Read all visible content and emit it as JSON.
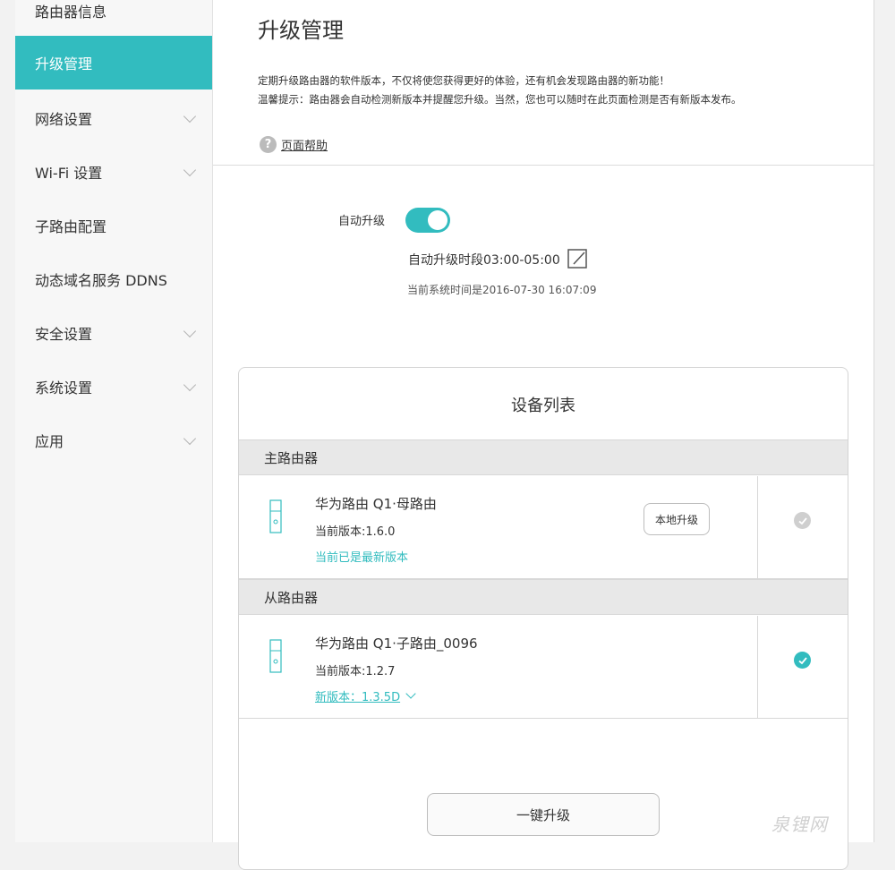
{
  "sidebar": {
    "items": [
      {
        "label": "路由器信息"
      },
      {
        "label": "升级管理"
      },
      {
        "label": "网络设置"
      },
      {
        "label": "Wi-Fi 设置"
      },
      {
        "label": "子路由配置"
      },
      {
        "label": "动态域名服务 DDNS"
      },
      {
        "label": "安全设置"
      },
      {
        "label": "系统设置"
      },
      {
        "label": "应用"
      }
    ]
  },
  "main": {
    "title": "升级管理",
    "desc1": "定期升级路由器的软件版本，不仅将使您获得更好的体验，还有机会发现路由器的新功能！",
    "desc2": "温馨提示：路由器会自动检测新版本并提醒您升级。当然，您也可以随时在此页面检测是否有新版本发布。",
    "help_label": "页面帮助",
    "help_icon": "?",
    "auto_upgrade_label": "自动升级",
    "auto_upgrade_on": true,
    "period": "自动升级时段03:00-05:00",
    "system_time": "当前系统时间是2016-07-30 16:07:09"
  },
  "device_list": {
    "title": "设备列表",
    "main_router_header": "主路由器",
    "main_router": {
      "name": "华为路由 Q1·母路由",
      "version": "当前版本:1.6.0",
      "status": "当前已是最新版本",
      "local_upgrade": "本地升级"
    },
    "sub_router_header": "从路由器",
    "sub_router": {
      "name": "华为路由 Q1·子路由_0096",
      "version": "当前版本:1.2.7",
      "new_version": "新版本：1.3.5D"
    },
    "one_click_upgrade": "一键升级"
  },
  "watermark": "泉锂网",
  "colors": {
    "accent": "#32bcbf",
    "sidebar_bg": "#f7f7f7",
    "section_bg": "#e8e8e8"
  }
}
